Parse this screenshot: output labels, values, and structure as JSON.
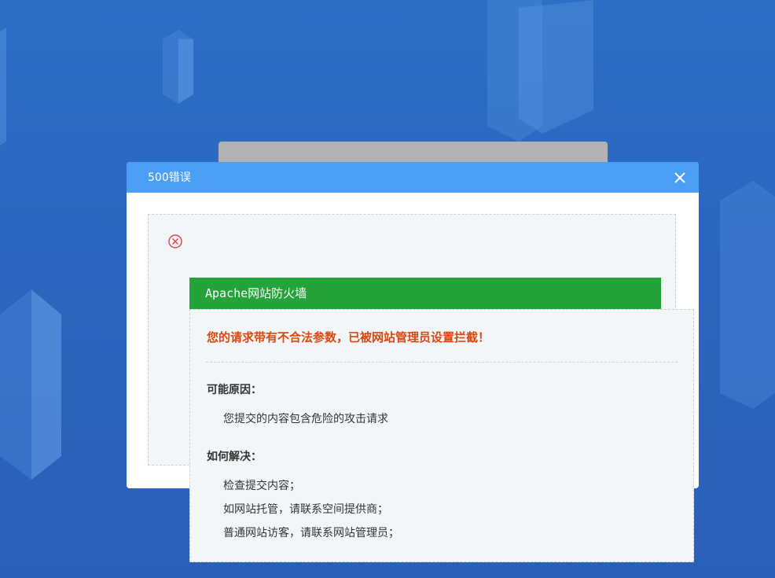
{
  "dialog": {
    "title": "500错误",
    "close_icon": "close-icon",
    "error_icon": "error-circle-x-icon"
  },
  "waf": {
    "header": "Apache网站防火墙",
    "message": "您的请求带有不合法参数，已被网站管理员设置拦截！",
    "reason_title": "可能原因：",
    "reasons": [
      "您提交的内容包含危险的攻击请求"
    ],
    "solution_title": "如何解决：",
    "solutions": [
      "检查提交内容；",
      "如网站托管，请联系空间提供商；",
      "普通网站访客，请联系网站管理员；"
    ]
  },
  "colors": {
    "header_blue": "#4a9ff5",
    "waf_green": "#23a33a",
    "warn_orange": "#d9480f"
  }
}
